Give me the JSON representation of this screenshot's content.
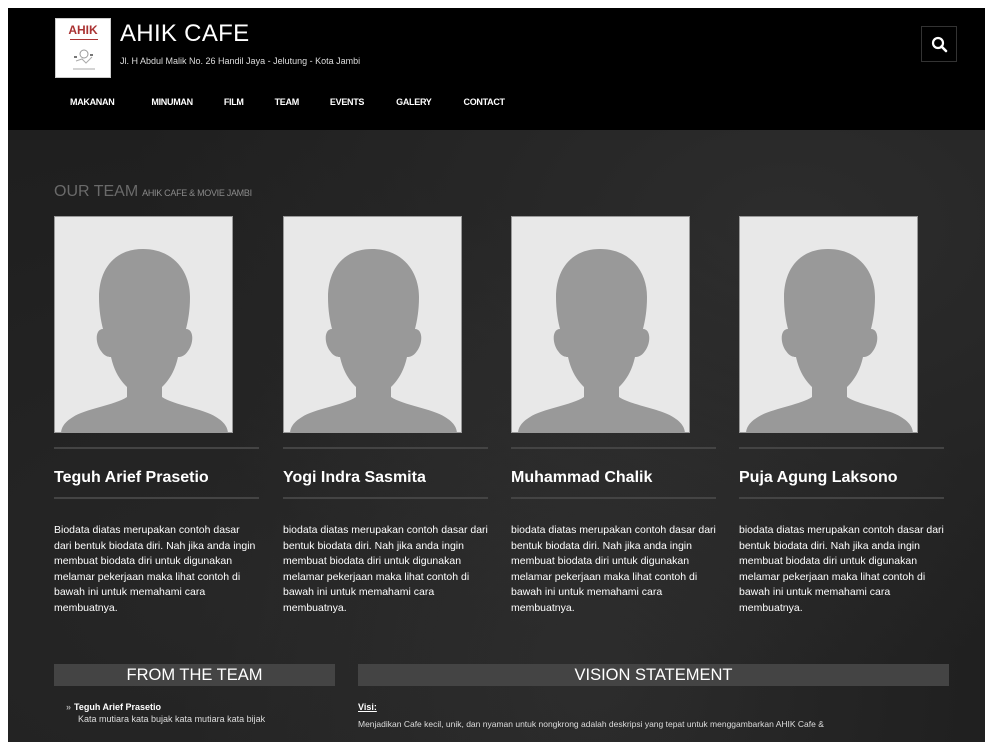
{
  "header": {
    "logo_text": "AHIK",
    "title": "AHIK CAFE",
    "address": "Jl. H Abdul Malik No. 26 Handil Jaya - Jelutung - Kota Jambi",
    "search_icon": "search-icon"
  },
  "nav": {
    "items": [
      {
        "label": "MAKANAN"
      },
      {
        "label": "MINUMAN"
      },
      {
        "label": "FILM"
      },
      {
        "label": "TEAM"
      },
      {
        "label": "EVENTS"
      },
      {
        "label": "GALERY"
      },
      {
        "label": "CONTACT"
      }
    ]
  },
  "team_section": {
    "title": "OUR TEAM",
    "subtitle": "AHIK CAFE & MOVIE JAMBI",
    "members": [
      {
        "name": "Teguh Arief Prasetio",
        "bio": "Biodata diatas merupakan contoh dasar dari bentuk biodata diri. Nah jika anda ingin membuat biodata diri untuk digunakan melamar pekerjaan maka lihat contoh di bawah ini untuk memahami cara membuatnya."
      },
      {
        "name": "Yogi Indra Sasmita",
        "bio": "biodata diatas merupakan contoh dasar dari bentuk biodata diri. Nah jika anda ingin membuat biodata diri untuk digunakan melamar pekerjaan maka lihat contoh di bawah ini untuk memahami cara membuatnya."
      },
      {
        "name": "Muhammad Chalik",
        "bio": "biodata diatas merupakan contoh dasar dari bentuk biodata diri. Nah jika anda ingin membuat biodata diri untuk digunakan melamar pekerjaan maka lihat contoh di bawah ini untuk memahami cara membuatnya."
      },
      {
        "name": "Puja Agung Laksono",
        "bio": "biodata diatas merupakan contoh dasar dari bentuk biodata diri. Nah jika anda ingin membuat biodata diri untuk digunakan melamar pekerjaan maka lihat contoh di bawah ini untuk memahami cara membuatnya."
      }
    ]
  },
  "from_the_team": {
    "heading": "FROM THE TEAM",
    "quote_name": "Teguh Arief Prasetio",
    "quote_text": "Kata mutiara kata bujak kata mutiara kata bijak"
  },
  "vision": {
    "heading": "VISION STATEMENT",
    "label": "Visi:",
    "text": "Menjadikan Cafe kecil, unik, dan nyaman untuk nongkrong adalah deskripsi yang tepat untuk menggambarkan AHIK Cafe &"
  },
  "colors": {
    "header_bg": "#000000",
    "page_bg": "#1f1f1f",
    "panel_head_bg": "#444444",
    "section_title": "#6a6a6a",
    "logo_accent": "#aa3333"
  }
}
